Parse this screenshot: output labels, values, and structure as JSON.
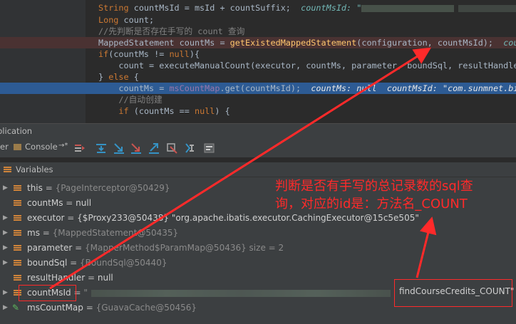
{
  "code": {
    "lines": [
      {
        "pre": "String countMsId = msId + countSuffix;",
        "hint": "countMsId: \"",
        "blur": true
      },
      {
        "pre": "Long count;"
      },
      {
        "pre": "//先判断是否存在手写的 count 查询",
        "comment": true
      },
      {
        "pre": "MappedStatement countMs = getExistedMappedStatement(configuration, countMsId);",
        "hint": "cou"
      },
      {
        "pre": "if(countMs != null){"
      },
      {
        "pre": "    count = executeManualCount(executor, countMs, parameter, boundSql, resultHandler"
      },
      {
        "pre": "} else {"
      },
      {
        "pre": "    countMs = msCountMap.get(countMsId);",
        "hint": "countMs: null  countMsId: \"com.sunmnet.big"
      },
      {
        "pre": "    //自动创建",
        "comment": true
      },
      {
        "pre": "    if (countMs == null) {"
      }
    ]
  },
  "tool_window": {
    "title": "plication",
    "console_tab": "Console",
    "tab_arrow": "→*"
  },
  "variables": {
    "header": "Variables",
    "rows": [
      {
        "name": "this",
        "value": "{PageInterceptor@50429}"
      },
      {
        "name": "countMs",
        "value": "null"
      },
      {
        "name": "executor",
        "value": "{$Proxy233@50438} \"org.apache.ibatis.executor.CachingExecutor@15c5e505\""
      },
      {
        "name": "ms",
        "value": "{MappedStatement@50435}"
      },
      {
        "name": "parameter",
        "value": "{MapperMethod$ParamMap@50436}  size = 2"
      },
      {
        "name": "boundSql",
        "value": "{BoundSql@50440}"
      },
      {
        "name": "resultHandler",
        "value": "null"
      },
      {
        "name": "countMsId",
        "value": "\""
      },
      {
        "name": "msCountMap",
        "value": "{GuavaCache@50456}"
      }
    ]
  },
  "annotation": {
    "line1": "判断是否有手写的总记录数的sql查",
    "line2": "询，对应的id是：方法名_COUNT",
    "value_box": "findCourseCredits_COUNT\""
  }
}
